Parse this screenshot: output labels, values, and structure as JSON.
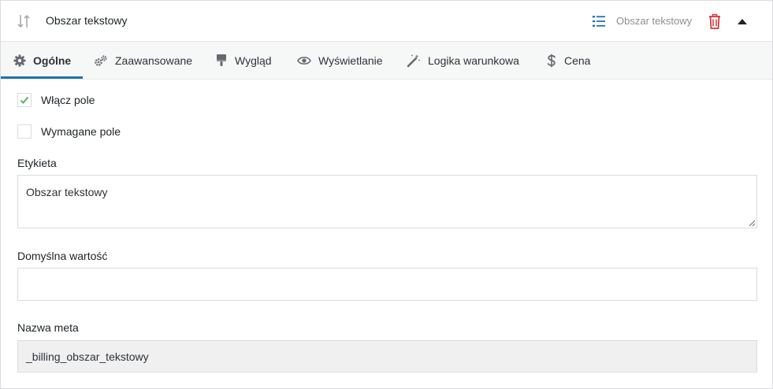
{
  "header": {
    "title": "Obszar tekstowy",
    "type_label": "Obszar tekstowy",
    "icons": {
      "drag": "sort-arrows-icon",
      "type": "list-icon",
      "delete": "trash-icon",
      "collapse": "caret-up-icon"
    },
    "colors": {
      "type_icon": "#2271b1",
      "delete_icon": "#d63638"
    }
  },
  "tabs": [
    {
      "label": "Ogólne",
      "icon": "gear-icon",
      "active": true
    },
    {
      "label": "Zaawansowane",
      "icon": "gears-icon",
      "active": false
    },
    {
      "label": "Wygląd",
      "icon": "paint-brush-icon",
      "active": false
    },
    {
      "label": "Wyświetlanie",
      "icon": "eye-icon",
      "active": false
    },
    {
      "label": "Logika warunkowa",
      "icon": "magic-wand-icon",
      "active": false
    },
    {
      "label": "Cena",
      "icon": "dollar-icon",
      "active": false
    }
  ],
  "form": {
    "enable_field": {
      "label": "Włącz pole",
      "checked": true
    },
    "required_field": {
      "label": "Wymagane pole",
      "checked": false
    },
    "label_field": {
      "label": "Etykieta",
      "value": "Obszar tekstowy"
    },
    "default_value": {
      "label": "Domyślna wartość",
      "value": ""
    },
    "meta_name": {
      "label": "Nazwa meta",
      "value": "_billing_obszar_tekstowy"
    }
  },
  "colors": {
    "accent": "#2271b1",
    "check": "#46b450"
  }
}
